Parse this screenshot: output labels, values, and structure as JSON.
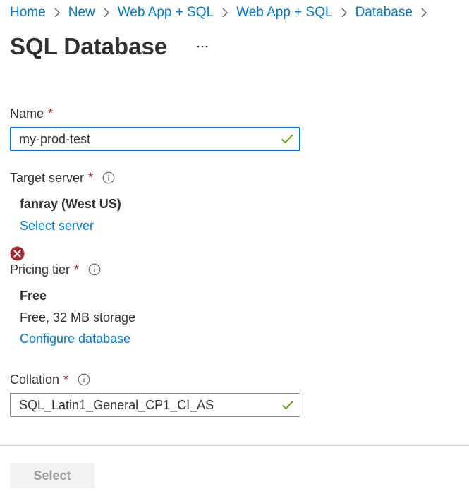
{
  "breadcrumb": {
    "items": [
      {
        "label": "Home"
      },
      {
        "label": "New"
      },
      {
        "label": "Web App + SQL"
      },
      {
        "label": "Web App + SQL"
      },
      {
        "label": "Database"
      }
    ]
  },
  "header": {
    "title": "SQL Database",
    "more_label": "···"
  },
  "form": {
    "name": {
      "label": "Name",
      "required": "*",
      "value": "my-prod-test",
      "status_icon": "check-icon"
    },
    "target_server": {
      "label": "Target server",
      "required": "*",
      "info_icon": "info-icon",
      "value": "fanray (West US)",
      "link": "Select server"
    },
    "pricing_tier": {
      "status_icon": "error-icon",
      "label": "Pricing tier",
      "required": "*",
      "info_icon": "info-icon",
      "value": "Free",
      "detail": "Free, 32 MB storage",
      "link": "Configure database"
    },
    "collation": {
      "label": "Collation",
      "required": "*",
      "info_icon": "info-icon",
      "value": "SQL_Latin1_General_CP1_CI_AS",
      "status_icon": "check-icon"
    }
  },
  "footer": {
    "select_label": "Select"
  },
  "colors": {
    "link": "#0078d4",
    "required": "#a4262c",
    "success": "#57a300",
    "error": "#a4262c",
    "focus_border": "#0078d4",
    "disabled_button_bg": "#f3f2f1",
    "disabled_button_text": "#a19f9d"
  }
}
